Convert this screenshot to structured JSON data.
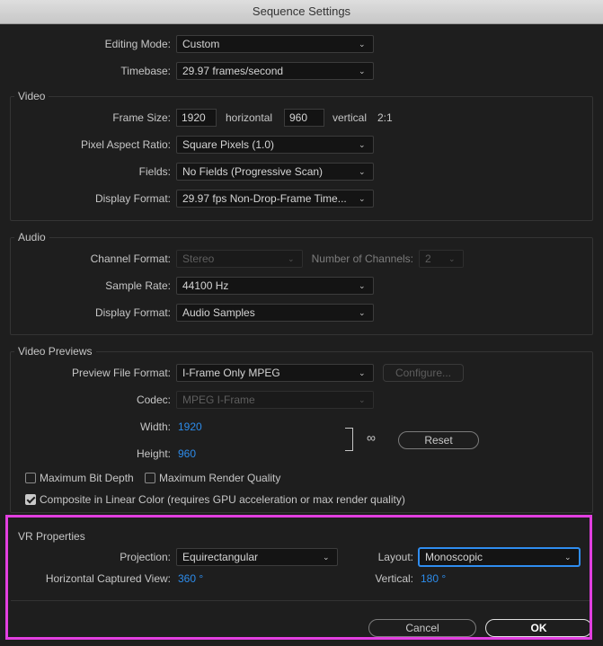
{
  "window": {
    "title": "Sequence Settings"
  },
  "general": {
    "editing_mode_label": "Editing Mode:",
    "editing_mode_value": "Custom",
    "timebase_label": "Timebase:",
    "timebase_value": "29.97  frames/second"
  },
  "video": {
    "section_title": "Video",
    "frame_size_label": "Frame Size:",
    "frame_width": "1920",
    "horizontal_label": "horizontal",
    "frame_height": "960",
    "vertical_label": "vertical",
    "aspect": "2:1",
    "pixel_aspect_label": "Pixel Aspect Ratio:",
    "pixel_aspect_value": "Square Pixels (1.0)",
    "fields_label": "Fields:",
    "fields_value": "No Fields (Progressive Scan)",
    "display_format_label": "Display Format:",
    "display_format_value": "29.97 fps Non-Drop-Frame Time..."
  },
  "audio": {
    "section_title": "Audio",
    "channel_format_label": "Channel Format:",
    "channel_format_value": "Stereo",
    "num_channels_label": "Number of Channels:",
    "num_channels_value": "2",
    "sample_rate_label": "Sample Rate:",
    "sample_rate_value": "44100 Hz",
    "display_format_label": "Display Format:",
    "display_format_value": "Audio Samples"
  },
  "previews": {
    "section_title": "Video Previews",
    "file_format_label": "Preview File Format:",
    "file_format_value": "I-Frame Only MPEG",
    "configure_label": "Configure...",
    "codec_label": "Codec:",
    "codec_value": "MPEG I-Frame",
    "width_label": "Width:",
    "width_value": "1920",
    "height_label": "Height:",
    "height_value": "960",
    "reset_label": "Reset",
    "max_bit_depth_label": "Maximum Bit Depth",
    "max_render_quality_label": "Maximum Render Quality",
    "linear_color_label": "Composite in Linear Color (requires GPU acceleration or max render quality)",
    "max_bit_depth_checked": false,
    "max_render_quality_checked": false,
    "linear_color_checked": true
  },
  "vr": {
    "section_title": "VR Properties",
    "projection_label": "Projection:",
    "projection_value": "Equirectangular",
    "layout_label": "Layout:",
    "layout_value": "Monoscopic",
    "h_view_label": "Horizontal Captured View:",
    "h_view_value": "360 °",
    "vertical_label": "Vertical:",
    "vertical_value": "180 °"
  },
  "footer": {
    "cancel_label": "Cancel",
    "ok_label": "OK"
  },
  "colors": {
    "accent_blue": "#2d8ceb",
    "highlight_magenta": "#e23fe0",
    "background": "#1e1e1e"
  },
  "icons": [
    "chevron-down-icon",
    "link-icon",
    "checkmark-icon"
  ]
}
